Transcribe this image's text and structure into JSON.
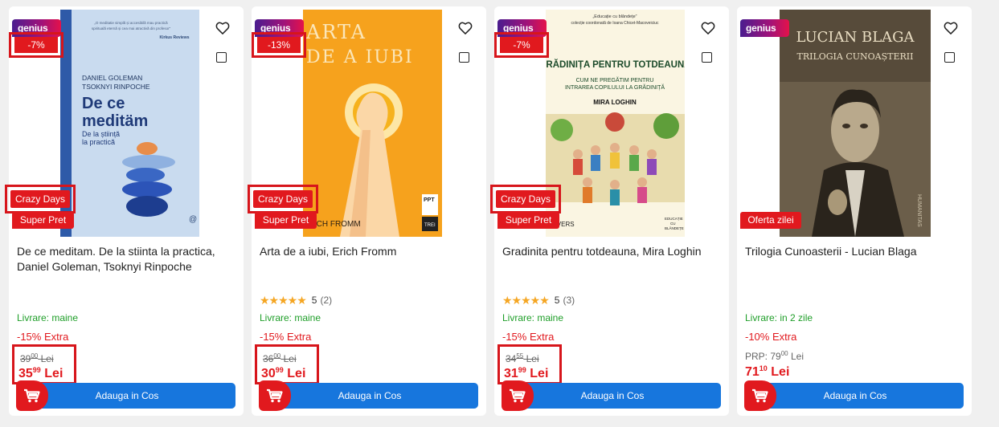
{
  "products": [
    {
      "genius": "genius",
      "discount": "-7%",
      "crazy": "Crazy Days",
      "tag": "Super Pret",
      "title": "De ce meditam. De la stiinta la practica, Daniel Goleman, Tsoknyi Rinpoche",
      "livrare": "Livrare: maine",
      "extra": "-15% Extra",
      "old_int": "39",
      "old_dec": "00",
      "old_cur": "Lei",
      "new_int": "35",
      "new_dec": "99",
      "new_cur": "Lei",
      "add_label": "Adauga in Cos",
      "cover": {
        "quote": "„O meditatie simplă și accesibilă mau practică spirituală eternă și cea mai atractivă din profesor”",
        "review_src": "Kirkus Reviews",
        "authors": "DANIEL GOLEMAN\nTSOKNYI RINPOCHE",
        "title_line1": "De ce",
        "title_line2": "meditäm",
        "subtitle": "De la știință\nla practică"
      }
    },
    {
      "genius": "genius",
      "discount": "-13%",
      "crazy": "Crazy Days",
      "tag": "Super Pret",
      "title": "Arta de a iubi, Erich Fromm",
      "stars": "★★★★★",
      "rating": "5",
      "rating_count": "(2)",
      "livrare": "Livrare: maine",
      "extra": "-15% Extra",
      "old_int": "36",
      "old_dec": "00",
      "old_cur": "Lei",
      "new_int": "30",
      "new_dec": "99",
      "new_cur": "Lei",
      "add_label": "Adauga in Cos",
      "cover": {
        "title_line1": "ARTA",
        "title_line2": "DE A IUBI",
        "author": "ERICH FROMM",
        "publisher": "TREI"
      }
    },
    {
      "genius": "genius",
      "discount": "-7%",
      "crazy": "Crazy Days",
      "tag": "Super Pret",
      "title": "Gradinita pentru totdeauna, Mira Loghin",
      "stars": "★★★★★",
      "rating": "5",
      "rating_count": "(3)",
      "livrare": "Livrare: maine",
      "extra": "-15% Extra",
      "old_int": "34",
      "old_dec": "55",
      "old_cur": "Lei",
      "new_int": "31",
      "new_dec": "99",
      "new_cur": "Lei",
      "add_label": "Adauga in Cos",
      "cover": {
        "series": "„Educație cu blândețe”\ncolecție coordonată de Ioana Chicet-Macoveiciuc",
        "title": "GRĂDINIȚA PENTRU TOTDEAUNA",
        "subtitle": "CUM NE PREGĂTIM PENTRU\nINTRAREA COPILULUI LA GRĂDINIȚĂ",
        "author": "MIRA LOGHIN",
        "publisher": "UNIVERS",
        "series_logo": "EDUCAȚIE\nCU\nBLÂNDEȚE"
      }
    },
    {
      "genius": "genius",
      "tag": "Oferta zilei",
      "title": "Trilogia Cunoasterii - Lucian Blaga",
      "livrare": "Livrare: in 2 zile",
      "extra": "-10% Extra",
      "prp_label": "PRP:",
      "old_int": "79",
      "old_dec": "00",
      "old_cur": "Lei",
      "new_int": "71",
      "new_dec": "10",
      "new_cur": "Lei",
      "add_label": "Adauga in Cos",
      "cover": {
        "author": "LUCIAN BLAGA",
        "title": "TRILOGIA CUNOAȘTERII",
        "publisher": "HUMANITAS"
      }
    }
  ]
}
